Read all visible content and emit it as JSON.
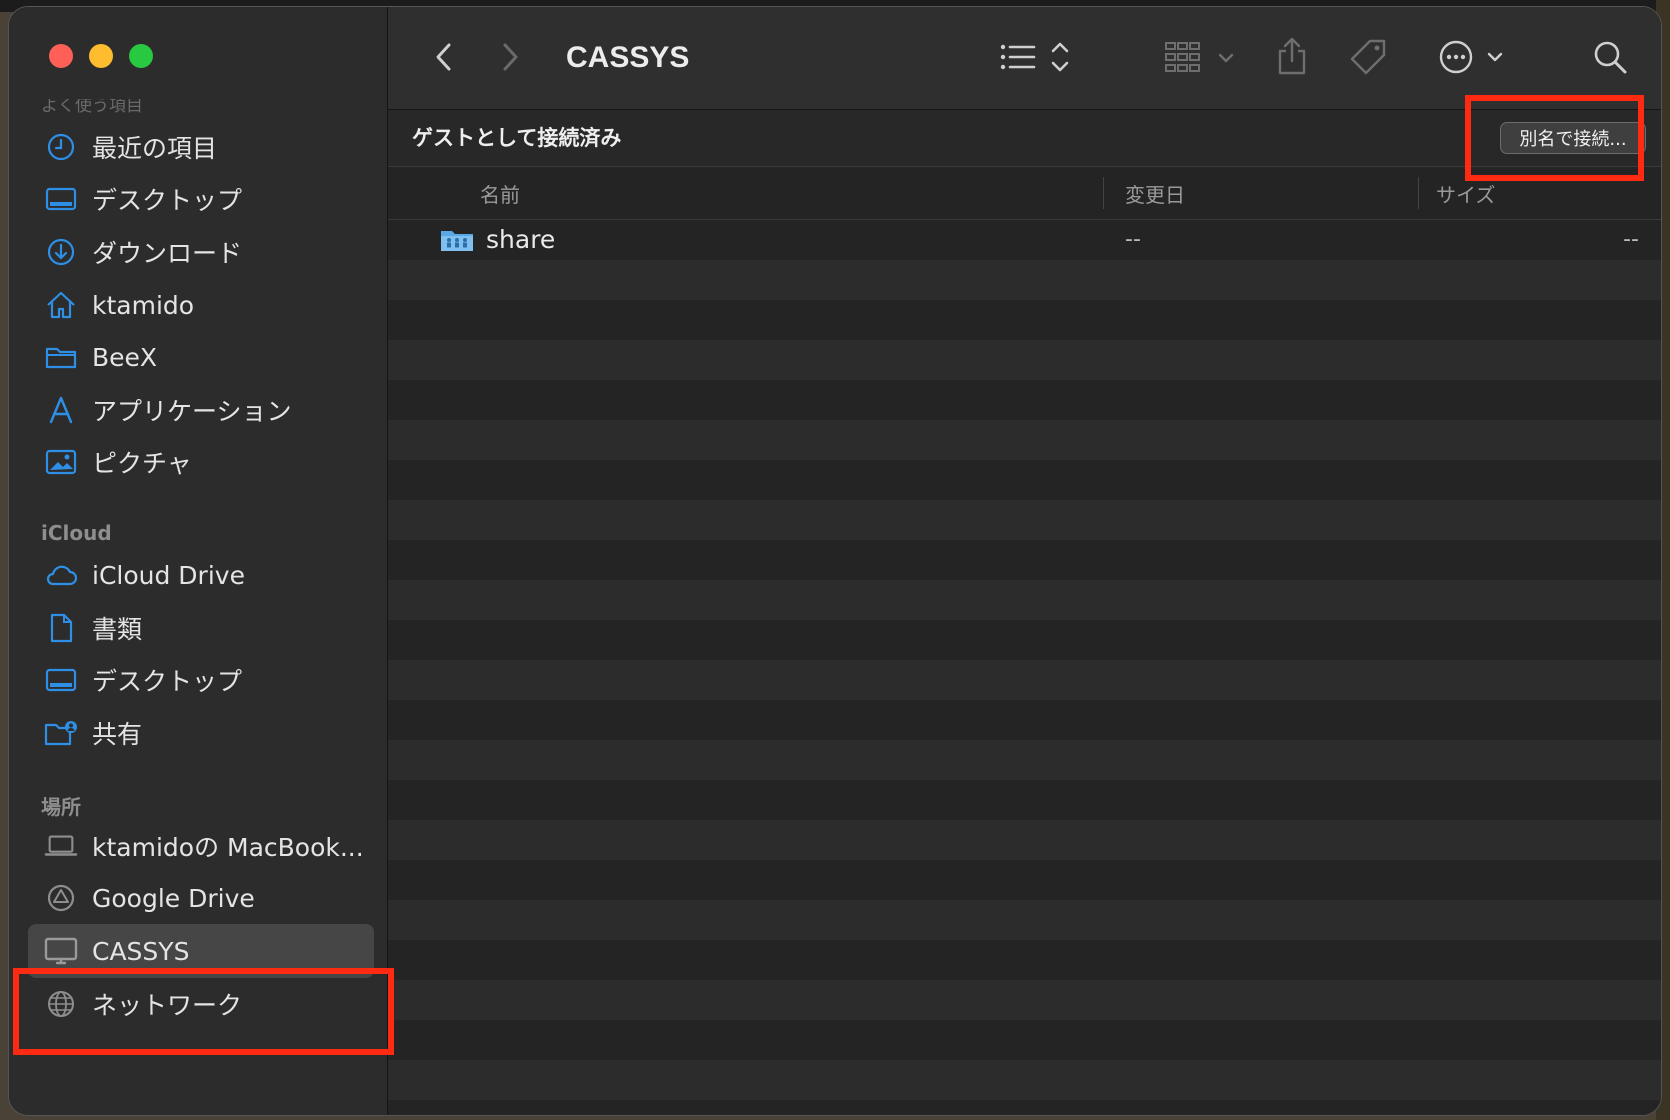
{
  "window": {
    "title": "CASSYS",
    "connection_status": "ゲストとして接続済み",
    "connect_as_label": "別名で接続..."
  },
  "sidebar": {
    "cut_section_label": "よく使う項目",
    "favorites": [
      {
        "label": "最近の項目",
        "icon": "clock-icon"
      },
      {
        "label": "デスクトップ",
        "icon": "desktop-icon"
      },
      {
        "label": "ダウンロード",
        "icon": "download-icon"
      },
      {
        "label": "ktamido",
        "icon": "home-icon"
      },
      {
        "label": "BeeX",
        "icon": "folder-icon"
      },
      {
        "label": "アプリケーション",
        "icon": "apps-icon"
      },
      {
        "label": "ピクチャ",
        "icon": "pictures-icon"
      }
    ],
    "icloud_header": "iCloud",
    "icloud": [
      {
        "label": "iCloud Drive",
        "icon": "cloud-icon"
      },
      {
        "label": "書類",
        "icon": "document-icon"
      },
      {
        "label": "デスクトップ",
        "icon": "desktop-icon"
      },
      {
        "label": "共有",
        "icon": "shared-folder-icon"
      }
    ],
    "locations_header": "場所",
    "locations": [
      {
        "label": "ktamidoの MacBook...",
        "icon": "laptop-icon"
      },
      {
        "label": "Google Drive",
        "icon": "drive-icon"
      },
      {
        "label": "CASSYS",
        "icon": "monitor-icon",
        "selected": true
      },
      {
        "label": "ネットワーク",
        "icon": "globe-icon"
      }
    ]
  },
  "columns": {
    "name": "名前",
    "modified": "変更日",
    "size": "サイズ"
  },
  "files": [
    {
      "name": "share",
      "modified": "--",
      "size": "--",
      "icon": "shared-folder-icon"
    }
  ],
  "colors": {
    "accent": "#2e8fe6",
    "highlight": "#ff2a12"
  }
}
